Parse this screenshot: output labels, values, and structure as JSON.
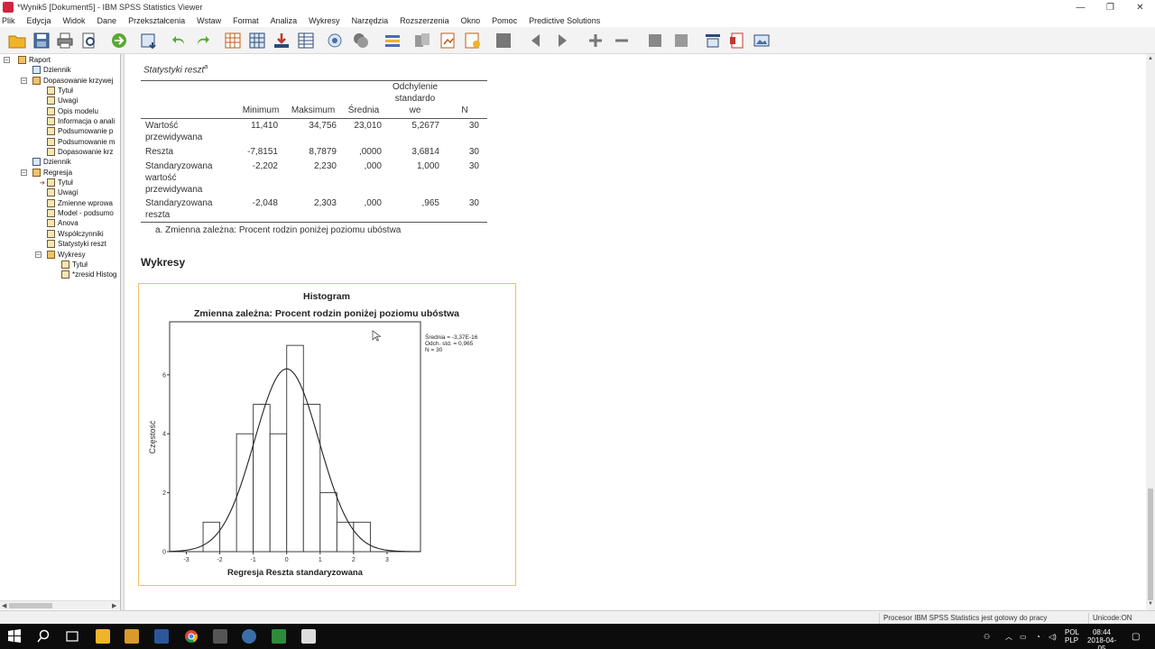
{
  "window": {
    "title": "*Wynik5 [Dokument5] - IBM SPSS Statistics Viewer",
    "controls": [
      "—",
      "❐",
      "✕"
    ]
  },
  "menu": [
    "Plik",
    "Edycja",
    "Widok",
    "Dane",
    "Przekształcenia",
    "Wstaw",
    "Format",
    "Analiza",
    "Wykresy",
    "Narzędzia",
    "Rozszerzenia",
    "Okno",
    "Pomoc",
    "Predictive Solutions"
  ],
  "outline": {
    "items": [
      {
        "label": "Raport",
        "level": 0,
        "icon": "book-icon"
      },
      {
        "label": "Dziennik",
        "level": 1,
        "icon": "log-icon"
      },
      {
        "label": "Dopasowanie krzywej",
        "level": 1,
        "icon": "book-icon"
      },
      {
        "label": "Tytuł",
        "level": 2,
        "icon": "page-icon"
      },
      {
        "label": "Uwagi",
        "level": 2,
        "icon": "page-icon"
      },
      {
        "label": "Opis modelu",
        "level": 2,
        "icon": "page-icon"
      },
      {
        "label": "Informacja o anali",
        "level": 2,
        "icon": "page-icon"
      },
      {
        "label": "Podsumowanie p",
        "level": 2,
        "icon": "page-icon"
      },
      {
        "label": "Podsumowanie m",
        "level": 2,
        "icon": "page-icon"
      },
      {
        "label": "Dopasowanie krz",
        "level": 2,
        "icon": "page-icon"
      },
      {
        "label": "Dziennik",
        "level": 1,
        "icon": "log-icon"
      },
      {
        "label": "Regresja",
        "level": 1,
        "icon": "book-icon"
      },
      {
        "label": "Tytuł",
        "level": 2,
        "icon": "page-icon"
      },
      {
        "label": "Uwagi",
        "level": 2,
        "icon": "page-icon"
      },
      {
        "label": "Zmienne wprowa",
        "level": 2,
        "icon": "page-icon"
      },
      {
        "label": "Model - podsumo",
        "level": 2,
        "icon": "page-icon"
      },
      {
        "label": "Anova",
        "level": 2,
        "icon": "page-icon"
      },
      {
        "label": "Współczynniki",
        "level": 2,
        "icon": "page-icon"
      },
      {
        "label": "Statystyki reszt",
        "level": 2,
        "icon": "page-icon"
      },
      {
        "label": "Wykresy",
        "level": 2,
        "icon": "book-icon"
      },
      {
        "label": "Tytuł",
        "level": 3,
        "icon": "page-icon"
      },
      {
        "label": "*zresid Histog",
        "level": 3,
        "icon": "chart-icon"
      }
    ]
  },
  "stats_table": {
    "title": "Statystyki reszt",
    "title_sup": "a",
    "headers": [
      "Minimum",
      "Maksimum",
      "Średnia",
      "Odchylenie standardowe",
      "N"
    ],
    "header_lines": {
      "odchylenie": [
        "Odchylenie",
        "standardo",
        "we"
      ]
    },
    "rows": [
      {
        "label_lines": [
          "Wartość",
          "przewidywana"
        ],
        "values": [
          "11,410",
          "34,756",
          "23,010",
          "5,2677",
          "30"
        ]
      },
      {
        "label_lines": [
          "Reszta"
        ],
        "values": [
          "-7,8151",
          "8,7879",
          ",0000",
          "3,6814",
          "30"
        ]
      },
      {
        "label_lines": [
          "Standaryzowana",
          "wartość",
          "przewidywana"
        ],
        "values": [
          "-2,202",
          "2,230",
          ",000",
          "1,000",
          "30"
        ]
      },
      {
        "label_lines": [
          "Standaryzowana",
          "reszta"
        ],
        "values": [
          "-2,048",
          "2,303",
          ",000",
          ",965",
          "30"
        ]
      }
    ],
    "footnote": "a. Zmienna zależna: Procent rodzin poniżej poziomu ubóstwa"
  },
  "section_title": "Wykresy",
  "chart_data": {
    "type": "bar",
    "title": "Histogram",
    "subtitle": "Zmienna zależna: Procent rodzin poniżej poziomu ubóstwa",
    "xlabel": "Regresja Reszta standaryzowana",
    "ylabel": "Częstość",
    "xlim": [
      -3.5,
      4.0
    ],
    "ylim": [
      0,
      7.8
    ],
    "xticks": [
      -3,
      -2,
      -1,
      0,
      1,
      2,
      3
    ],
    "xtick_labels": [
      "-3",
      "-2",
      "-1",
      "0",
      "1",
      "2",
      "3"
    ],
    "yticks": [
      0,
      2,
      4,
      6
    ],
    "ytick_labels": [
      "0",
      "2",
      "4",
      "6"
    ],
    "bin_width": 0.5,
    "bin_starts": [
      -2.5,
      -2.0,
      -1.5,
      -1.0,
      -0.5,
      0.0,
      0.5,
      1.0,
      1.5,
      2.0
    ],
    "values": [
      0,
      1,
      0,
      4,
      5,
      4,
      7,
      5,
      2,
      1,
      1
    ],
    "bins": [
      {
        "x0": -2.5,
        "x1": -2.0,
        "value": 1
      },
      {
        "x0": -1.5,
        "x1": -1.0,
        "value": 4
      },
      {
        "x0": -1.0,
        "x1": -0.5,
        "value": 5
      },
      {
        "x0": -0.5,
        "x1": 0.0,
        "value": 4
      },
      {
        "x0": 0.0,
        "x1": 0.5,
        "value": 7
      },
      {
        "x0": 0.5,
        "x1": 1.0,
        "value": 5
      },
      {
        "x0": 1.0,
        "x1": 1.5,
        "value": 2
      },
      {
        "x0": 1.5,
        "x1": 2.0,
        "value": 1
      },
      {
        "x0": 2.0,
        "x1": 2.5,
        "value": 1
      }
    ],
    "normal_curve": {
      "mean": 0,
      "sd": 0.965,
      "n": 30
    },
    "legend": [
      "Średnia = -3,37E-16",
      "Odch. std. = 0,965",
      "N = 30"
    ],
    "legend_position": "top-right",
    "grid": false
  },
  "status": {
    "message": "Procesor IBM SPSS Statistics  jest gotowy do pracy",
    "encoding": "Unicode:ON"
  },
  "taskbar": {
    "lang_top": "POL",
    "lang_bottom": "PLP",
    "time": "08:44",
    "date": "2018-04-05"
  }
}
